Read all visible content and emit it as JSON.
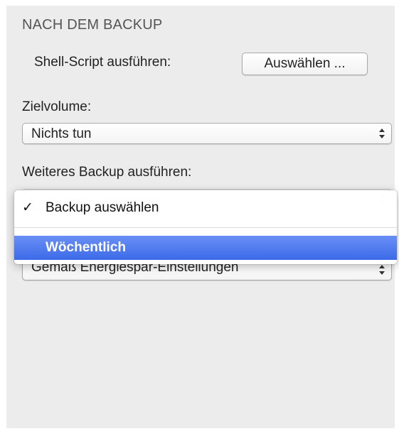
{
  "section": {
    "title": "NACH DEM BACKUP"
  },
  "shell_script": {
    "label": "Shell-Script ausführen:",
    "button_label": "Auswählen ..."
  },
  "target_volume": {
    "label": "Zielvolume:",
    "value": "Nichts tun"
  },
  "further_backup": {
    "label": "Weiteres Backup ausführen:",
    "menu": {
      "items": [
        {
          "label": "Backup auswählen",
          "checked": true
        },
        {
          "label": "Wöchentlich",
          "highlighted": true
        }
      ]
    }
  },
  "partially_hidden_select": {
    "value": "Gemäß Energiespar-Einstellungen"
  },
  "colors": {
    "panel_bg": "#ececec",
    "highlight": "#3c6ae8",
    "text": "#222222"
  },
  "icons": {
    "select_arrows": "up-down-arrows-icon",
    "checkmark": "checkmark-icon"
  }
}
